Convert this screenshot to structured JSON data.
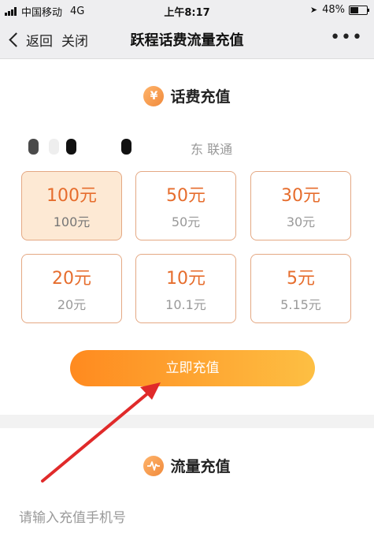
{
  "status_bar": {
    "carrier": "中国移动",
    "network": "4G",
    "time": "上午8:17",
    "battery": "48%",
    "battery_level": 0.48
  },
  "nav": {
    "back_label": "返回",
    "close_label": "关闭",
    "title": "跃程话费流量充值",
    "more_label": "•••"
  },
  "phone_recharge": {
    "title": "话费充值",
    "icon": "yen-icon",
    "icon_glyph": "¥",
    "phone_masked_colors": [
      "#4a4a4a",
      "#eeeeee",
      "#111111",
      "#111111"
    ],
    "carrier_label": "东 联通",
    "options": [
      {
        "label": "100元",
        "price": "100元",
        "selected": true
      },
      {
        "label": "50元",
        "price": "50元",
        "selected": false
      },
      {
        "label": "30元",
        "price": "30元",
        "selected": false
      },
      {
        "label": "20元",
        "price": "20元",
        "selected": false
      },
      {
        "label": "10元",
        "price": "10.1元",
        "selected": false
      },
      {
        "label": "5元",
        "price": "5.15元",
        "selected": false
      }
    ],
    "submit_label": "立即充值"
  },
  "data_recharge": {
    "title": "流量充值",
    "icon": "pulse-icon",
    "input_placeholder": "请输入充值手机号"
  },
  "annotation": {
    "color": "#e02a2a"
  },
  "colors": {
    "accent": "#e66d2d",
    "button_gradient_start": "#ff8a1f",
    "button_gradient_end": "#fdbf43",
    "selected_bg": "#fde9d4"
  }
}
